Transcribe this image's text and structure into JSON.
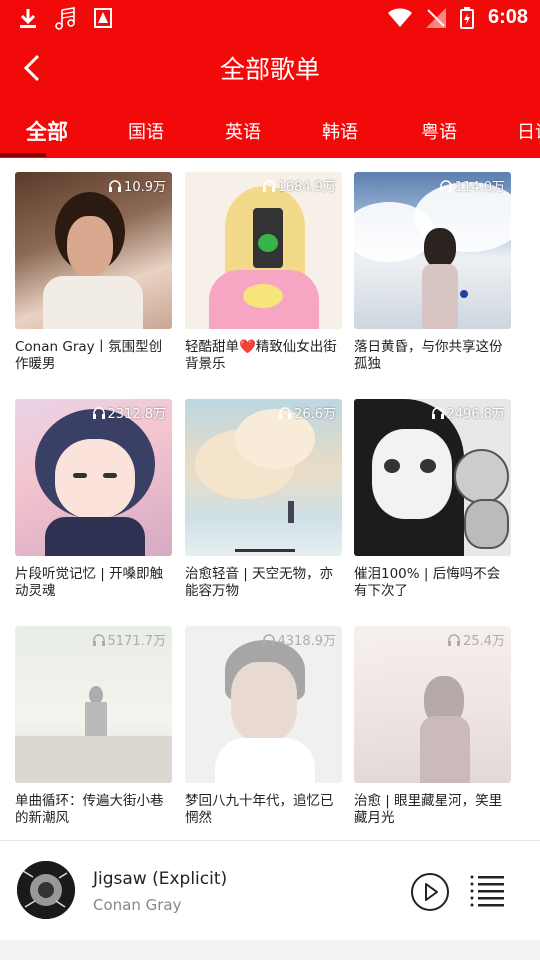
{
  "status_bar": {
    "time": "6:08",
    "left_icons": [
      "download-icon",
      "music-icon",
      "warning-icon"
    ],
    "right_icons": [
      "wifi-icon",
      "no-signal-icon",
      "battery-icon"
    ]
  },
  "header": {
    "back_icon": "chevron-left-icon",
    "title": "全部歌单"
  },
  "tabs": [
    {
      "label": "全部",
      "active": true
    },
    {
      "label": "国语"
    },
    {
      "label": "英语"
    },
    {
      "label": "韩语"
    },
    {
      "label": "粤语"
    },
    {
      "label": "日语"
    }
  ],
  "playlists": [
    {
      "count": "10.9万",
      "title": "Conan Gray丨氛围型创作暖男"
    },
    {
      "count": "1684.9万",
      "title": "轻酷甜单❤️精致仙女出街背景乐"
    },
    {
      "count": "114.0万",
      "title": "落日黄昏，与你共享这份孤独"
    },
    {
      "count": "2312.8万",
      "title": "片段听觉记忆 | 开嗓即触动灵魂"
    },
    {
      "count": "26.6万",
      "title": "治愈轻音 | 天空无物，亦能容万物"
    },
    {
      "count": "2496.8万",
      "title": "催泪100% | 后悔吗不会有下次了"
    },
    {
      "count": "5171.7万",
      "title": "单曲循环：传遍大街小巷的新潮风"
    },
    {
      "count": "4318.9万",
      "title": "梦回八九十年代，追忆已惘然"
    },
    {
      "count": "25.4万",
      "title": "治愈 | 眼里藏星河，笑里藏月光"
    }
  ],
  "now_playing": {
    "song": "Jigsaw (Explicit)",
    "artist": "Conan Gray"
  },
  "colors": {
    "brand_red": "#f20a0a",
    "indicator": "#8a0000"
  }
}
